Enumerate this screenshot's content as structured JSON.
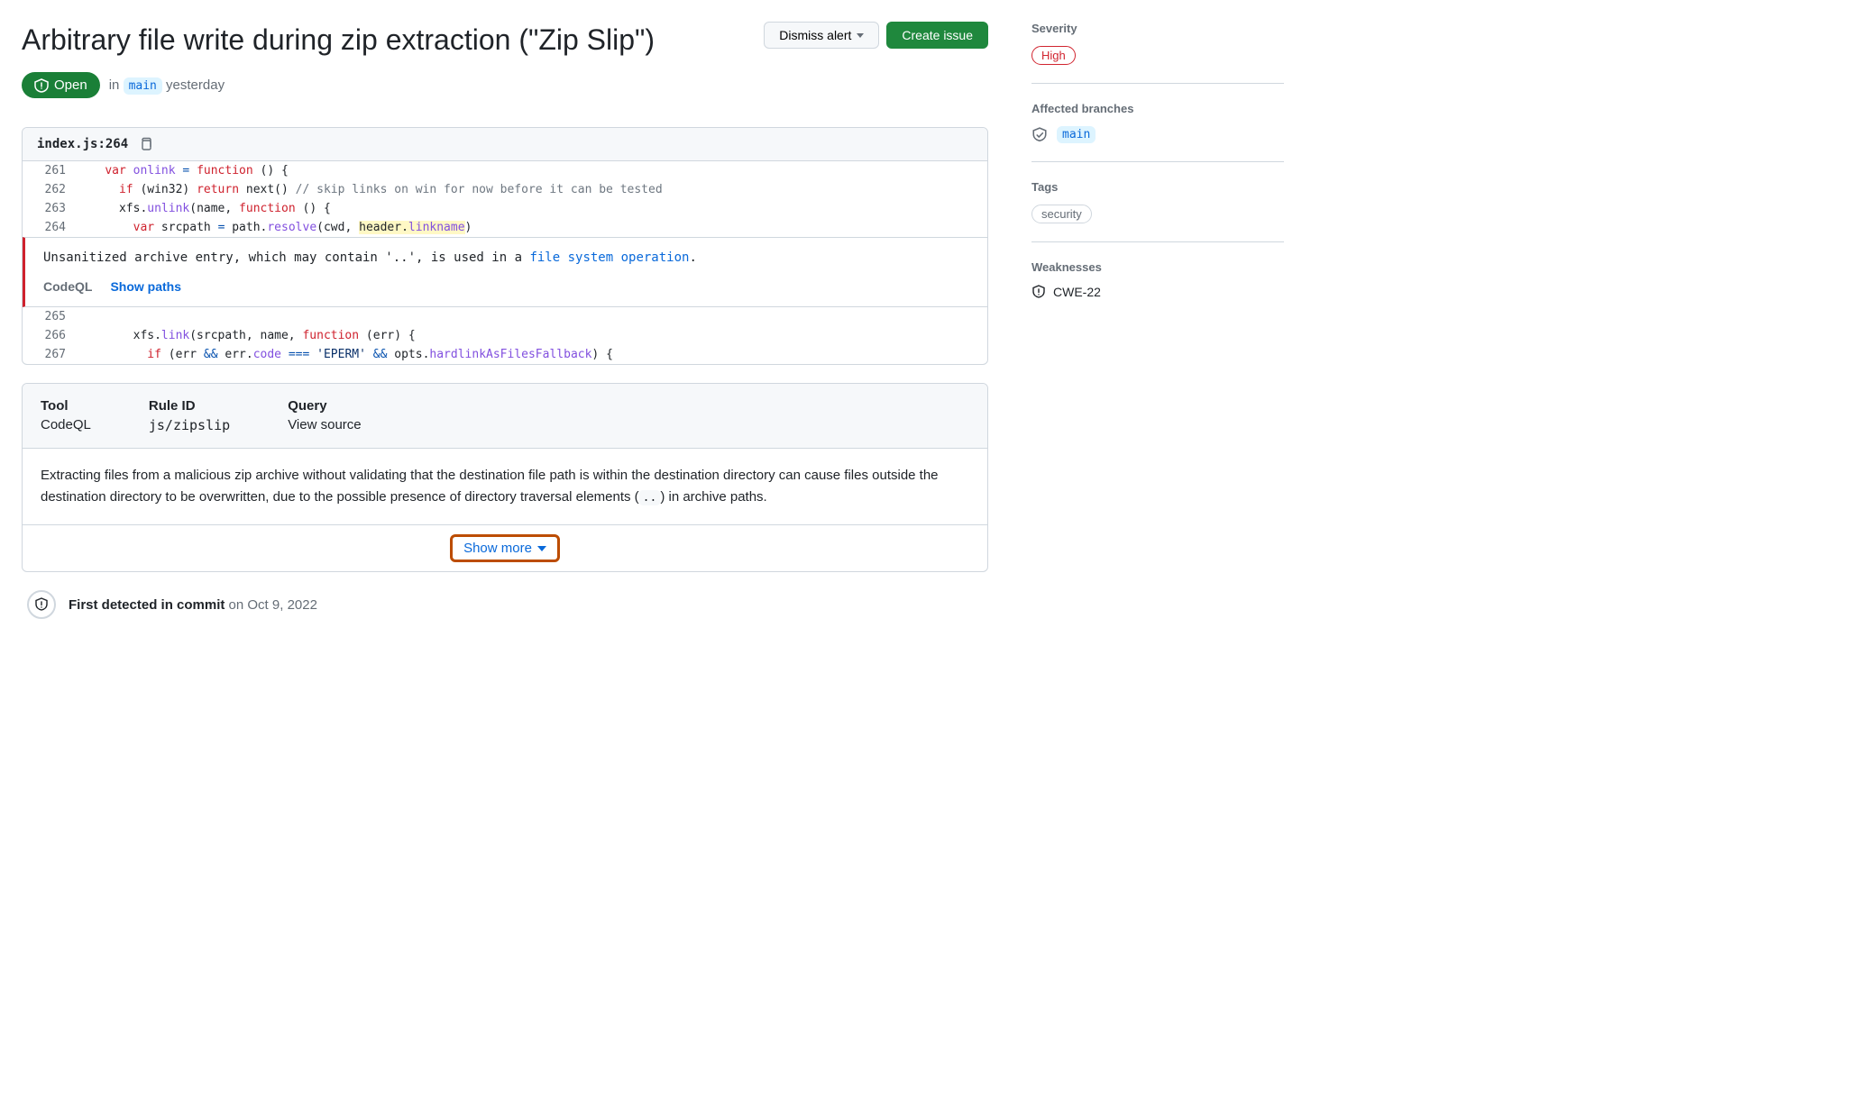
{
  "header": {
    "title": "Arbitrary file write during zip extraction (\"Zip Slip\")",
    "dismiss_label": "Dismiss alert",
    "create_issue_label": "Create issue"
  },
  "status": {
    "state": "Open",
    "in_label": "in",
    "branch": "main",
    "time": "yesterday"
  },
  "code": {
    "file": "index.js",
    "line_ref": "264",
    "lines": [
      {
        "num": "261"
      },
      {
        "num": "262"
      },
      {
        "num": "263"
      },
      {
        "num": "264"
      }
    ],
    "lines2": [
      {
        "num": "265"
      },
      {
        "num": "266"
      },
      {
        "num": "267"
      }
    ]
  },
  "alert": {
    "msg_pre": "Unsanitized archive entry, which may contain '..', is used in a ",
    "msg_link": "file system operation",
    "msg_post": ".",
    "tool": "CodeQL",
    "show_paths": "Show paths"
  },
  "info": {
    "tool_label": "Tool",
    "tool_value": "CodeQL",
    "rule_label": "Rule ID",
    "rule_value": "js/zipslip",
    "query_label": "Query",
    "query_value": "View source",
    "description_pre": "Extracting files from a malicious zip archive without validating that the destination file path is within the destination directory can cause files outside the destination directory to be overwritten, due to the possible presence of directory traversal elements (",
    "description_code": "..",
    "description_post": ") in archive paths.",
    "show_more": "Show more"
  },
  "timeline": {
    "bold": "First detected in commit",
    "rest": " on Oct 9, 2022"
  },
  "sidebar": {
    "severity_label": "Severity",
    "severity_value": "High",
    "branches_label": "Affected branches",
    "branches_value": "main",
    "tags_label": "Tags",
    "tags_value": "security",
    "weaknesses_label": "Weaknesses",
    "weaknesses_value": "CWE-22"
  }
}
